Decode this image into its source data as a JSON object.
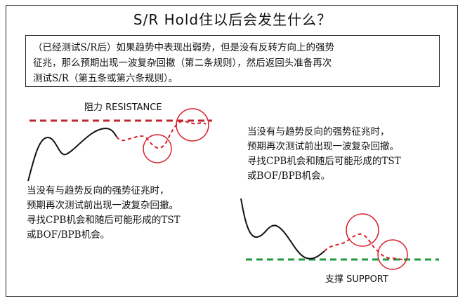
{
  "title": "S/R Hold住以后会发生什么？",
  "note_lines": [
    "（已经测试S/R后）如果趋势中表现出弱势，但是没有反转方向上的强势",
    "征兆，那么预期出现一波复杂回撤（第二条规则），然后返回头准备再次",
    "测试S/R（第五条或第六条规则）。"
  ],
  "resistance_label": "阻力 RESISTANCE",
  "support_label": "支撑 SUPPORT",
  "desc_upper": [
    "当没有与趋势反向的强势征兆时，",
    "预期再次测试前出现一波复杂回撤。",
    "寻找CPB机会和随后可能形成的TST",
    "或BOF/BPB机会。"
  ],
  "desc_lower": [
    "当没有与趋势反向的强势征兆时，",
    "预期再次测试前出现一波复杂回撤。",
    "寻找CPB机会和随后可能形成的TST",
    "或BOF/BPB机会。"
  ],
  "colors": {
    "resistance": "#c0262d",
    "support": "#1e9a3e",
    "price": "#111111",
    "pullback": "#d8202b",
    "circle": "#d8202b"
  }
}
